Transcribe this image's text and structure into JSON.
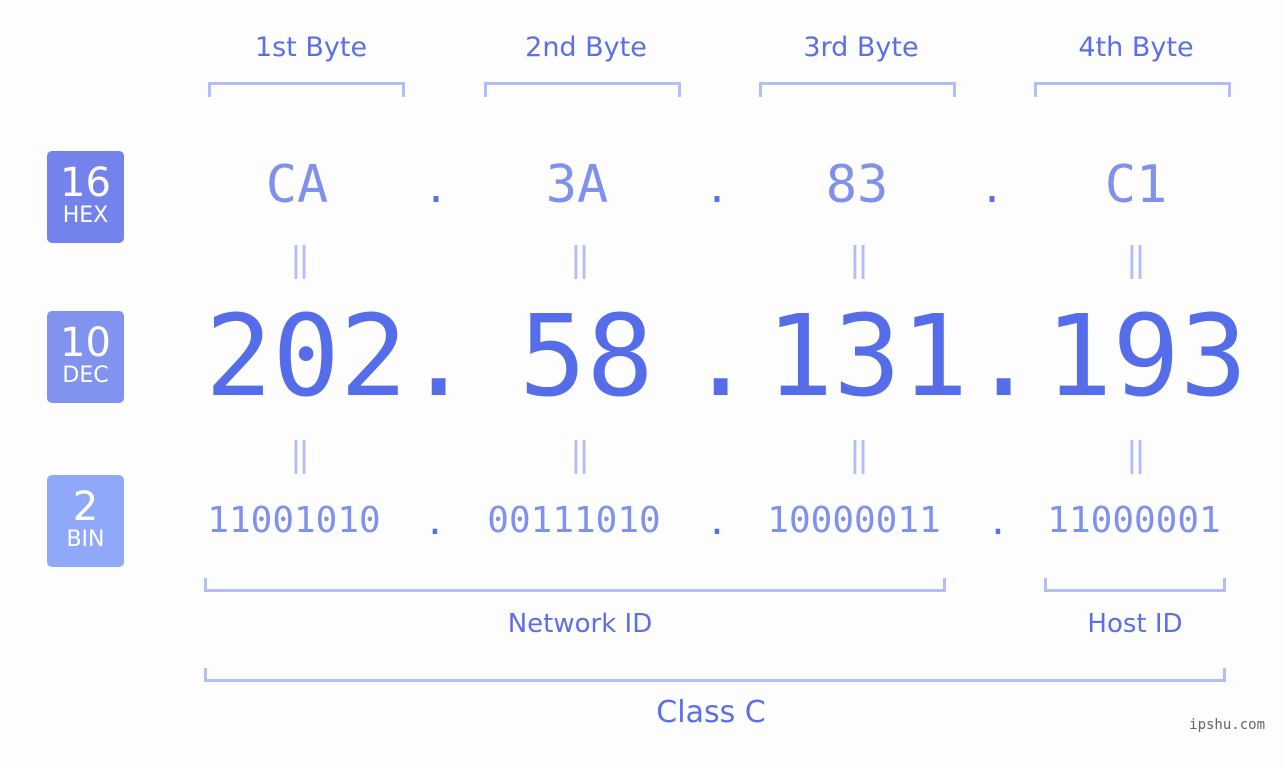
{
  "bytes": [
    {
      "label": "1st Byte",
      "hex": "CA",
      "dec": "202",
      "bin": "11001010"
    },
    {
      "label": "2nd Byte",
      "hex": "3A",
      "dec": "58",
      "bin": "00111010"
    },
    {
      "label": "3rd Byte",
      "hex": "83",
      "dec": "131",
      "bin": "10000011"
    },
    {
      "label": "4th Byte",
      "hex": "C1",
      "dec": "193",
      "bin": "11000001"
    }
  ],
  "separator": ".",
  "equals": "=",
  "badges": {
    "hex": {
      "num": "16",
      "label": "HEX",
      "color": "#7383eb"
    },
    "dec": {
      "num": "10",
      "label": "DEC",
      "color": "#8292ef"
    },
    "bin": {
      "num": "2",
      "label": "BIN",
      "color": "#8fa8f9"
    }
  },
  "network_id_label": "Network ID",
  "host_id_label": "Host ID",
  "class_label": "Class C",
  "watermark": "ipshu.com",
  "colors": {
    "accent": "#566de9",
    "light": "#8090ed",
    "bracket": "#b3bdf7"
  }
}
